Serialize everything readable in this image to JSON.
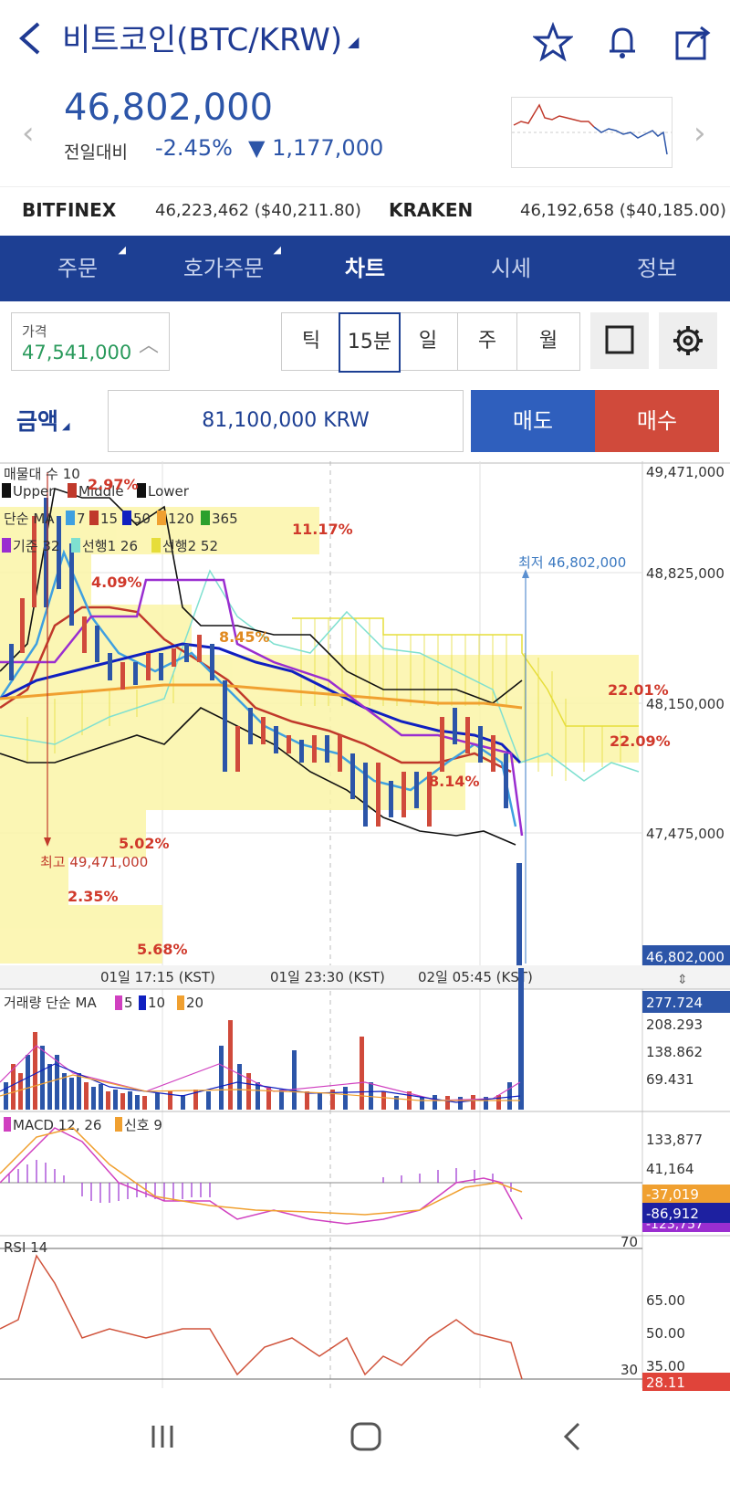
{
  "header": {
    "title": "비트코인(BTC/KRW)",
    "icons": [
      "back-arrow-icon",
      "star-icon",
      "bell-icon",
      "share-icon"
    ]
  },
  "ticker": {
    "price": "46,802,000",
    "change_label": "전일대비",
    "change_pct": "-2.45%",
    "change_amt": "▼ 1,177,000"
  },
  "exchanges": [
    {
      "name": "BITFINEX",
      "value": "46,223,462 ($40,211.80)"
    },
    {
      "name": "KRAKEN",
      "value": "46,192,658 ($40,185.00)"
    }
  ],
  "tabs": [
    {
      "label": "주문",
      "marker": true
    },
    {
      "label": "호가주문",
      "marker": true
    },
    {
      "label": "차트",
      "active": true
    },
    {
      "label": "시세"
    },
    {
      "label": "정보"
    }
  ],
  "controls": {
    "price_label": "가격",
    "price_value": "47,541,000",
    "intervals": [
      "틱",
      "15분",
      "일",
      "주",
      "월"
    ],
    "active_interval": "15분",
    "amount_label": "금액",
    "amount_value": "81,100,000 KRW",
    "sell_label": "매도",
    "buy_label": "매수"
  },
  "chart": {
    "price_axis": [
      "49,471,000",
      "48,825,000",
      "48,150,000",
      "47,475,000"
    ],
    "current_price": "46,802,000",
    "time_axis": [
      "01일 17:15 (KST)",
      "01일 23:30 (KST)",
      "02일 05:45 (KST)"
    ],
    "legend_lines": [
      "매물대 수 10",
      "Upper Middle Lower",
      "단순 MA 7 15 50 120 365",
      "기준 32 선행1 26 선행2 52"
    ],
    "legend_items": {
      "bb": [
        "Upper",
        "Middle",
        "Lower"
      ],
      "ma_label": "단순 MA",
      "ma": [
        "7",
        "15",
        "50",
        "120",
        "365"
      ],
      "ich": [
        "기준 32",
        "선행1 26",
        "선행2 52"
      ],
      "vp_label": "매물대 수 10"
    },
    "volume_profile_pcts": [
      "2.97%",
      "11.17%",
      "4.09%",
      "8.45%",
      "22.01%",
      "22.09%",
      "8.14%",
      "5.02%",
      "2.35%",
      "5.68%"
    ],
    "high_label": "최고 49,471,000",
    "low_label": "최저 46,802,000",
    "volume": {
      "label": "거래량 단순 MA",
      "ma": [
        "5",
        "10",
        "20"
      ],
      "axis": [
        "277.724",
        "208.293",
        "138.862",
        "69.431"
      ],
      "current": "277.724"
    },
    "macd": {
      "label": "MACD 12, 26",
      "signal_label": "신호 9",
      "axis": [
        "133,877",
        "41,164"
      ],
      "signal_value": "-37,019",
      "macd_value": "-86,912",
      "hidden_value": "-123,757"
    },
    "rsi": {
      "label": "RSI 14",
      "axis": [
        "65.00",
        "50.00",
        "35.00"
      ],
      "upper": "70",
      "lower": "30",
      "current": "28.11"
    }
  },
  "colors": {
    "brand": "#1d3f93",
    "down": "#2c55a8",
    "up": "#d04a3b"
  }
}
